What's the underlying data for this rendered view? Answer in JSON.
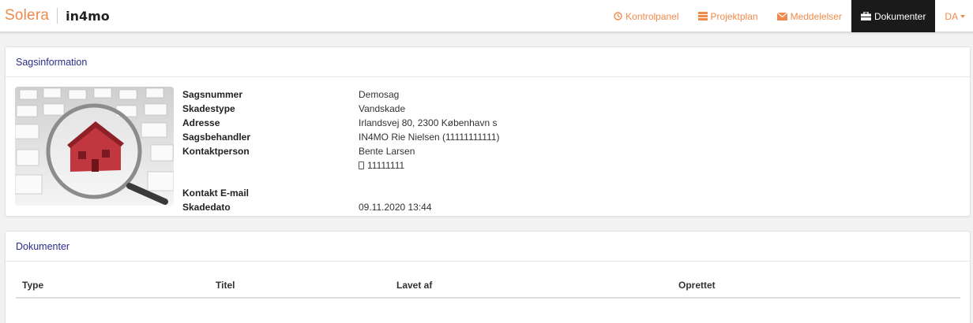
{
  "brand": {
    "logo_left": "Solera",
    "logo_right": "in4mo"
  },
  "nav": {
    "items": [
      {
        "label": "Kontrolpanel",
        "icon": "dashboard-icon"
      },
      {
        "label": "Projektplan",
        "icon": "list-icon"
      },
      {
        "label": "Meddelelser",
        "icon": "envelope-icon"
      },
      {
        "label": "Dokumenter",
        "icon": "briefcase-icon",
        "active": true
      }
    ],
    "language": "DA"
  },
  "case_panel": {
    "title": "Sagsinformation",
    "fields": [
      {
        "label": "Sagsnummer",
        "value": "Demosag"
      },
      {
        "label": "Skadestype",
        "value": "Vandskade"
      },
      {
        "label": "Adresse",
        "value": "Irlandsvej 80, 2300 København s"
      },
      {
        "label": "Sagsbehandler",
        "value": "IN4MO Rie Nielsen (11111111111)"
      },
      {
        "label": "Kontaktperson",
        "value": "Bente Larsen"
      },
      {
        "label": "",
        "value": "11111111"
      },
      {
        "label": "Kontakt E-mail",
        "value": ""
      },
      {
        "label": "Skadedato",
        "value": "09.11.2020 13:44"
      }
    ]
  },
  "docs_panel": {
    "title": "Dokumenter",
    "columns": [
      "Type",
      "Titel",
      "Lavet af",
      "Oprettet"
    ]
  },
  "colors": {
    "accent": "#f08a4b",
    "panel_title": "#2c2c8c",
    "active_nav": "#1a1a1a"
  }
}
